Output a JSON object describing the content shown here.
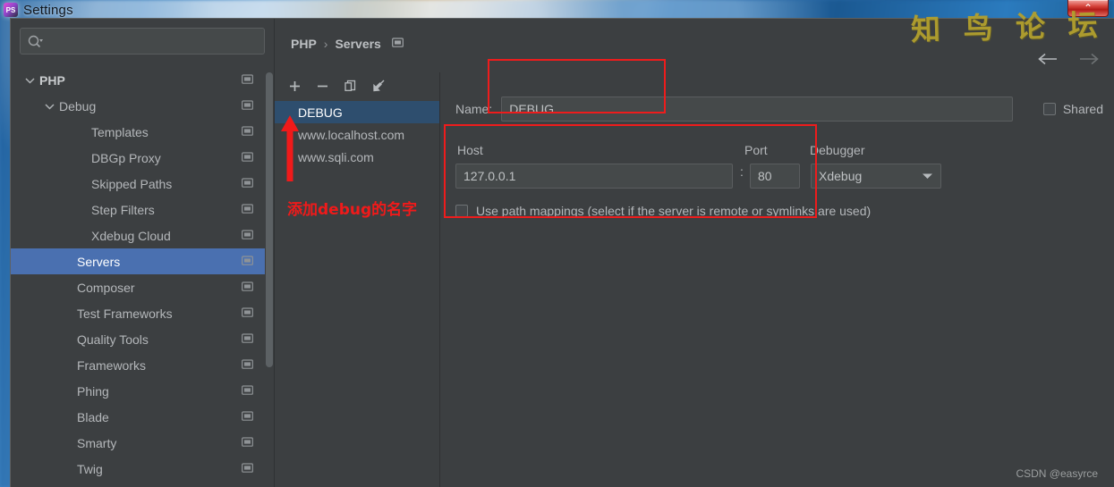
{
  "window": {
    "title": "Settings",
    "app_icon": "phpstorm-icon",
    "close_label": "⌃"
  },
  "watermark": {
    "forum": "知 鸟 论 坛",
    "csdn": "CSDN @easyrce"
  },
  "search": {
    "placeholder": "",
    "value": "",
    "icon": "search-icon"
  },
  "tree": {
    "items": [
      {
        "label": "PHP",
        "level": 0,
        "arrow": "chevron-down",
        "bold": true,
        "selected": false,
        "icon": "screen-icon"
      },
      {
        "label": "Debug",
        "level": 1,
        "arrow": "chevron-down",
        "bold": false,
        "selected": false,
        "icon": "screen-icon"
      },
      {
        "label": "Templates",
        "level": 2,
        "arrow": "none",
        "bold": false,
        "selected": false,
        "icon": "screen-icon"
      },
      {
        "label": "DBGp Proxy",
        "level": 2,
        "arrow": "none",
        "bold": false,
        "selected": false,
        "icon": "screen-icon"
      },
      {
        "label": "Skipped Paths",
        "level": 2,
        "arrow": "none",
        "bold": false,
        "selected": false,
        "icon": "screen-icon"
      },
      {
        "label": "Step Filters",
        "level": 2,
        "arrow": "none",
        "bold": false,
        "selected": false,
        "icon": "screen-icon"
      },
      {
        "label": "Xdebug Cloud",
        "level": 2,
        "arrow": "none",
        "bold": false,
        "selected": false,
        "icon": "screen-icon"
      },
      {
        "label": "Servers",
        "level": 1,
        "arrow": "none",
        "bold": false,
        "selected": true,
        "icon": "screen-icon"
      },
      {
        "label": "Composer",
        "level": 1,
        "arrow": "none",
        "bold": false,
        "selected": false,
        "icon": "screen-icon"
      },
      {
        "label": "Test Frameworks",
        "level": 1,
        "arrow": "none",
        "bold": false,
        "selected": false,
        "icon": "screen-icon"
      },
      {
        "label": "Quality Tools",
        "level": 1,
        "arrow": "none",
        "bold": false,
        "selected": false,
        "icon": "screen-icon"
      },
      {
        "label": "Frameworks",
        "level": 1,
        "arrow": "none",
        "bold": false,
        "selected": false,
        "icon": "screen-icon"
      },
      {
        "label": "Phing",
        "level": 1,
        "arrow": "none",
        "bold": false,
        "selected": false,
        "icon": "screen-icon"
      },
      {
        "label": "Blade",
        "level": 1,
        "arrow": "none",
        "bold": false,
        "selected": false,
        "icon": "screen-icon"
      },
      {
        "label": "Smarty",
        "level": 1,
        "arrow": "none",
        "bold": false,
        "selected": false,
        "icon": "screen-icon"
      },
      {
        "label": "Twig",
        "level": 1,
        "arrow": "none",
        "bold": false,
        "selected": false,
        "icon": "screen-icon"
      }
    ]
  },
  "breadcrumb": {
    "root": "PHP",
    "separator": "›",
    "current": "Servers",
    "icon": "screen-icon"
  },
  "nav": {
    "back_icon": "arrow-left-icon",
    "forward_icon": "arrow-right-icon"
  },
  "server_toolbar": {
    "add": "+",
    "remove": "−",
    "copy_icon": "copy-icon",
    "import_icon": "import-arrow-icon"
  },
  "servers": {
    "items": [
      {
        "label": "DEBUG",
        "selected": true
      },
      {
        "label": "www.localhost.com",
        "selected": false
      },
      {
        "label": "www.sqli.com",
        "selected": false
      }
    ]
  },
  "annotation": {
    "note": "添加debug的名字",
    "arrow_icon": "red-up-arrow-icon",
    "color": "#ee1c1c"
  },
  "form": {
    "name_label": "Name:",
    "name_value": "DEBUG",
    "shared_label": "Shared",
    "shared_checked": false,
    "host_label": "Host",
    "host_value": "127.0.0.1",
    "colon": ":",
    "port_label": "Port",
    "port_value": "80",
    "debugger_label": "Debugger",
    "debugger_value": "Xdebug",
    "debugger_caret": "chevron-down-icon",
    "path_mappings_label": "Use path mappings (select if the server is remote or symlinks are used)",
    "path_mappings_checked": false
  },
  "colors": {
    "dialog_bg": "#3c3f41",
    "field_bg": "#45494a",
    "selection_blue": "#4a70b0",
    "list_selection": "#2e4e6e",
    "annotation_red": "#ee1c1c",
    "watermark_gold": "#b2a02e"
  }
}
